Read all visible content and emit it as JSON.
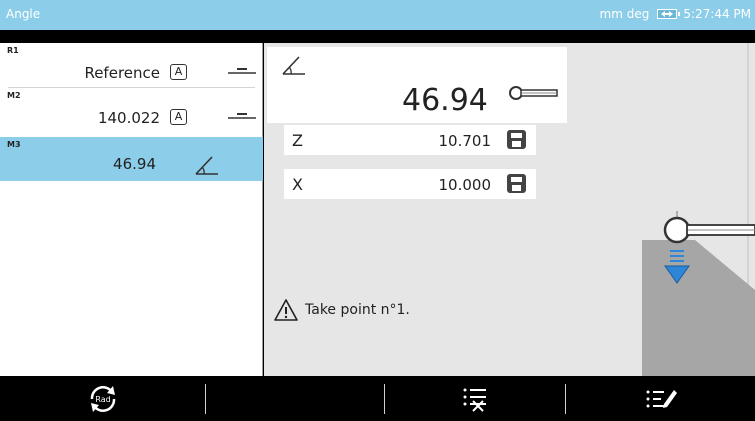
{
  "window": {
    "title": "Angle",
    "units_label": "mm deg",
    "time": "5:27:44 PM"
  },
  "elements": [
    {
      "tag": "R1",
      "value": "Reference",
      "mode": "A"
    },
    {
      "tag": "M2",
      "value": "140.022",
      "mode": "A"
    },
    {
      "tag": "M3",
      "value": "46.94",
      "selected": true
    }
  ],
  "result": {
    "value": "46.94"
  },
  "coordinates": [
    {
      "axis": "Z",
      "value": "10.701"
    },
    {
      "axis": "X",
      "value": "10.000"
    }
  ],
  "instruction": "Take point n°1.",
  "toolbar": {
    "buttons": [
      {
        "name": "rad-toggle-button",
        "label": "Rad",
        "icon": "refresh-rad-icon"
      },
      {
        "name": "delete-points-button",
        "icon": "list-delete-icon"
      },
      {
        "name": "edit-list-button",
        "icon": "list-edit-icon"
      }
    ]
  },
  "colors": {
    "accent": "#8ccde9",
    "toolbar": "#000000",
    "probe_arrow": "#2f86d6"
  }
}
